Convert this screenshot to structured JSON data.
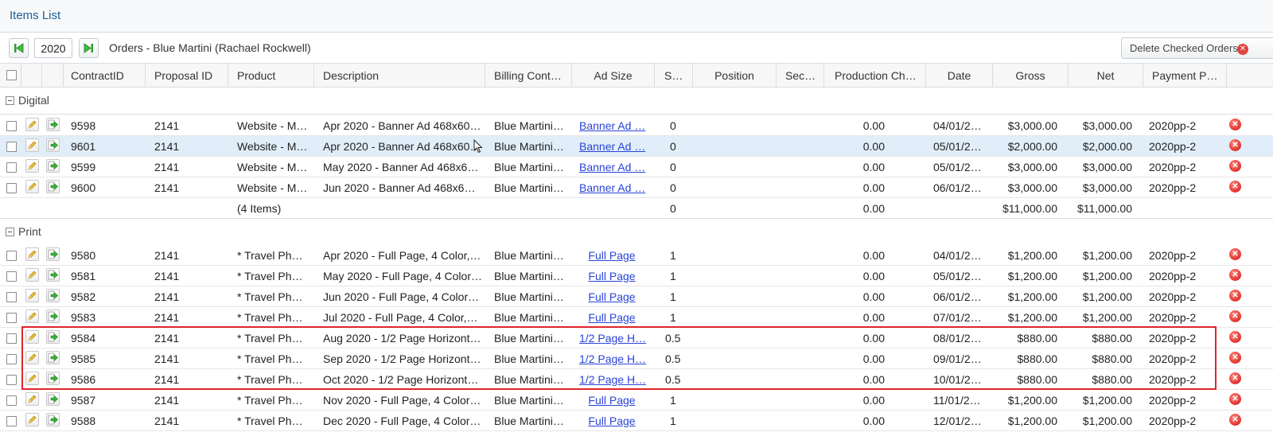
{
  "window": {
    "title": "Items List"
  },
  "toolbar": {
    "year": "2020",
    "orders_label": "Orders - Blue Martini (Rachael Rockwell)",
    "delete_label": "Delete Checked Orders"
  },
  "columns": {
    "contract_id": "ContractID",
    "proposal_id": "Proposal ID",
    "product": "Product",
    "description": "Description",
    "billing": "Billing Cont…",
    "ad_size": "Ad Size",
    "s": "S…",
    "position": "Position",
    "sec": "Sec…",
    "production": "Production Ch…",
    "date": "Date",
    "gross": "Gross",
    "net": "Net",
    "payment": "Payment P…"
  },
  "groups": {
    "digital": {
      "label": "Digital",
      "rows": [
        {
          "contract": "9598",
          "proposal": "2141",
          "product": "Website - M…",
          "description": "Apr 2020 - Banner Ad 468x60…",
          "billing": "Blue Martini…",
          "ad_size": "Banner Ad …",
          "s": "0",
          "production": "0.00",
          "date": "04/01/2…",
          "gross": "$3,000.00",
          "net": "$3,000.00",
          "payment": "2020pp-2"
        },
        {
          "contract": "9601",
          "proposal": "2141",
          "product": "Website - M…",
          "description": "Apr 2020 - Banner Ad 468x60…",
          "billing": "Blue Martini…",
          "ad_size": "Banner Ad …",
          "s": "0",
          "production": "0.00",
          "date": "05/01/2…",
          "gross": "$2,000.00",
          "net": "$2,000.00",
          "payment": "2020pp-2"
        },
        {
          "contract": "9599",
          "proposal": "2141",
          "product": "Website - M…",
          "description": "May 2020 - Banner Ad 468x6…",
          "billing": "Blue Martini…",
          "ad_size": "Banner Ad …",
          "s": "0",
          "production": "0.00",
          "date": "05/01/2…",
          "gross": "$3,000.00",
          "net": "$3,000.00",
          "payment": "2020pp-2"
        },
        {
          "contract": "9600",
          "proposal": "2141",
          "product": "Website - M…",
          "description": "Jun 2020 - Banner Ad 468x6…",
          "billing": "Blue Martini…",
          "ad_size": "Banner Ad …",
          "s": "0",
          "production": "0.00",
          "date": "06/01/2…",
          "gross": "$3,000.00",
          "net": "$3,000.00",
          "payment": "2020pp-2"
        }
      ],
      "summary": {
        "count": "(4 Items)",
        "s": "0",
        "production": "0.00",
        "gross": "$11,000.00",
        "net": "$11,000.00"
      }
    },
    "print": {
      "label": "Print",
      "rows": [
        {
          "contract": "9580",
          "proposal": "2141",
          "product": "* Travel Ph…",
          "description": "Apr 2020 - Full Page, 4 Color,…",
          "billing": "Blue Martini…",
          "ad_size": "Full Page",
          "s": "1",
          "production": "0.00",
          "date": "04/01/2…",
          "gross": "$1,200.00",
          "net": "$1,200.00",
          "payment": "2020pp-2"
        },
        {
          "contract": "9581",
          "proposal": "2141",
          "product": "* Travel Ph…",
          "description": "May 2020 - Full Page, 4 Color…",
          "billing": "Blue Martini…",
          "ad_size": "Full Page",
          "s": "1",
          "production": "0.00",
          "date": "05/01/2…",
          "gross": "$1,200.00",
          "net": "$1,200.00",
          "payment": "2020pp-2"
        },
        {
          "contract": "9582",
          "proposal": "2141",
          "product": "* Travel Ph…",
          "description": "Jun 2020 - Full Page, 4 Color…",
          "billing": "Blue Martini…",
          "ad_size": "Full Page",
          "s": "1",
          "production": "0.00",
          "date": "06/01/2…",
          "gross": "$1,200.00",
          "net": "$1,200.00",
          "payment": "2020pp-2"
        },
        {
          "contract": "9583",
          "proposal": "2141",
          "product": "* Travel Ph…",
          "description": "Jul 2020 - Full Page, 4 Color,…",
          "billing": "Blue Martini…",
          "ad_size": "Full Page",
          "s": "1",
          "production": "0.00",
          "date": "07/01/2…",
          "gross": "$1,200.00",
          "net": "$1,200.00",
          "payment": "2020pp-2"
        },
        {
          "contract": "9584",
          "proposal": "2141",
          "product": "* Travel Ph…",
          "description": "Aug 2020 - 1/2 Page Horizont…",
          "billing": "Blue Martini…",
          "ad_size": "1/2 Page H…",
          "s": "0.5",
          "production": "0.00",
          "date": "08/01/2…",
          "gross": "$880.00",
          "net": "$880.00",
          "payment": "2020pp-2"
        },
        {
          "contract": "9585",
          "proposal": "2141",
          "product": "* Travel Ph…",
          "description": "Sep 2020 - 1/2 Page Horizont…",
          "billing": "Blue Martini…",
          "ad_size": "1/2 Page H…",
          "s": "0.5",
          "production": "0.00",
          "date": "09/01/2…",
          "gross": "$880.00",
          "net": "$880.00",
          "payment": "2020pp-2"
        },
        {
          "contract": "9586",
          "proposal": "2141",
          "product": "* Travel Ph…",
          "description": "Oct 2020 - 1/2 Page Horizont…",
          "billing": "Blue Martini…",
          "ad_size": "1/2 Page H…",
          "s": "0.5",
          "production": "0.00",
          "date": "10/01/2…",
          "gross": "$880.00",
          "net": "$880.00",
          "payment": "2020pp-2"
        },
        {
          "contract": "9587",
          "proposal": "2141",
          "product": "* Travel Ph…",
          "description": "Nov 2020 - Full Page, 4 Color…",
          "billing": "Blue Martini…",
          "ad_size": "Full Page",
          "s": "1",
          "production": "0.00",
          "date": "11/01/2…",
          "gross": "$1,200.00",
          "net": "$1,200.00",
          "payment": "2020pp-2"
        },
        {
          "contract": "9588",
          "proposal": "2141",
          "product": "* Travel Ph…",
          "description": "Dec 2020 - Full Page, 4 Color…",
          "billing": "Blue Martini…",
          "ad_size": "Full Page",
          "s": "1",
          "production": "0.00",
          "date": "12/01/2…",
          "gross": "$1,200.00",
          "net": "$1,200.00",
          "payment": "2020pp-2"
        }
      ]
    }
  },
  "icons": {
    "first": "first-page-icon",
    "last": "last-page-icon",
    "edit": "pencil-icon",
    "open": "arrow-right-icon",
    "delete": "delete-icon",
    "collapse": "collapse-icon"
  },
  "colors": {
    "title": "#1b5d96",
    "link": "#2a44d6",
    "delete": "#e0302a",
    "selected_row": "#e1eef9",
    "highlight": "#e0252a"
  }
}
